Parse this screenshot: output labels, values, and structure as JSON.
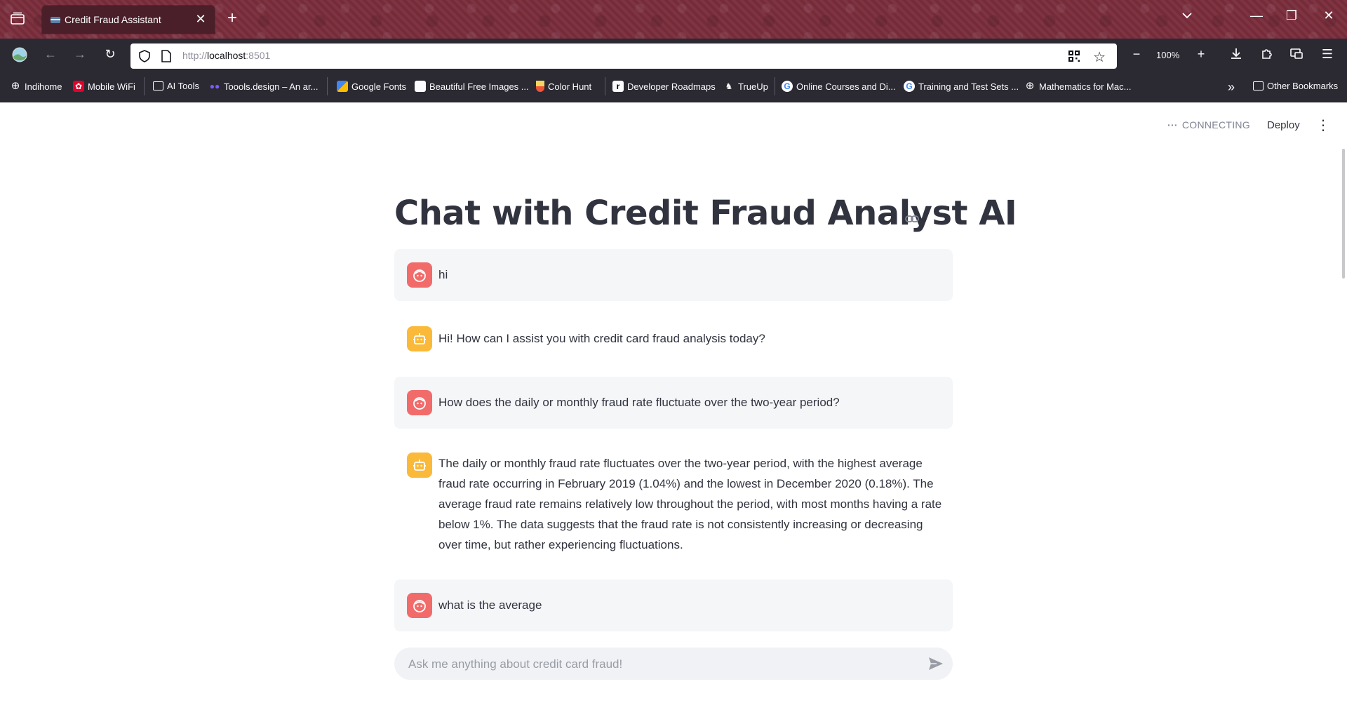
{
  "browser": {
    "tab_title": "Credit Fraud Assistant",
    "url_scheme": "http://",
    "url_host": "localhost",
    "url_port": ":8501",
    "zoom": "100%"
  },
  "bookmarks": [
    {
      "label": "Indihome",
      "icon": "globe-icon"
    },
    {
      "label": "Mobile WiFi",
      "icon": "huawei-icon"
    },
    {
      "label": "AI Tools",
      "icon": "folder-icon"
    },
    {
      "label": "Toools.design – An ar...",
      "icon": "toools-icon"
    },
    {
      "label": "Google Fonts",
      "icon": "google-fonts-icon"
    },
    {
      "label": "Beautiful Free Images ...",
      "icon": "unsplash-icon"
    },
    {
      "label": "Color Hunt",
      "icon": "color-hunt-icon"
    },
    {
      "label": "Developer Roadmaps",
      "icon": "roadmap-icon"
    },
    {
      "label": "TrueUp",
      "icon": "trueup-icon"
    },
    {
      "label": "Online Courses and Di...",
      "icon": "google-icon"
    },
    {
      "label": "Training and Test Sets ...",
      "icon": "google-icon"
    },
    {
      "label": "Mathematics for Mac...",
      "icon": "globe-icon"
    },
    {
      "label": "Other Bookmarks",
      "icon": "folder-icon"
    }
  ],
  "app": {
    "status": "CONNECTING",
    "deploy_label": "Deploy",
    "title": "Chat with Credit Fraud Analyst AI",
    "messages": [
      {
        "role": "user",
        "text": "hi"
      },
      {
        "role": "assistant",
        "text": "Hi! How can I assist you with credit card fraud analysis today?"
      },
      {
        "role": "user",
        "text": "How does the daily or monthly fraud rate fluctuate over the two-year period?"
      },
      {
        "role": "assistant",
        "text": "The daily or monthly fraud rate fluctuates over the two-year period, with the highest average fraud rate occurring in February 2019 (1.04%) and the lowest in December 2020 (0.18%). The average fraud rate remains relatively low throughout the period, with most months having a rate below 1%. The data suggests that the fraud rate is not consistently increasing or decreasing over time, but rather experiencing fluctuations."
      },
      {
        "role": "user",
        "text": "what is the average"
      }
    ],
    "input_placeholder": "Ask me anything about credit card fraud!"
  },
  "colors": {
    "user_avatar": "#f26b6b",
    "assistant_avatar": "#fbb93a",
    "user_bubble": "#f5f6f8",
    "tabstrip": "#7b2d3c"
  }
}
